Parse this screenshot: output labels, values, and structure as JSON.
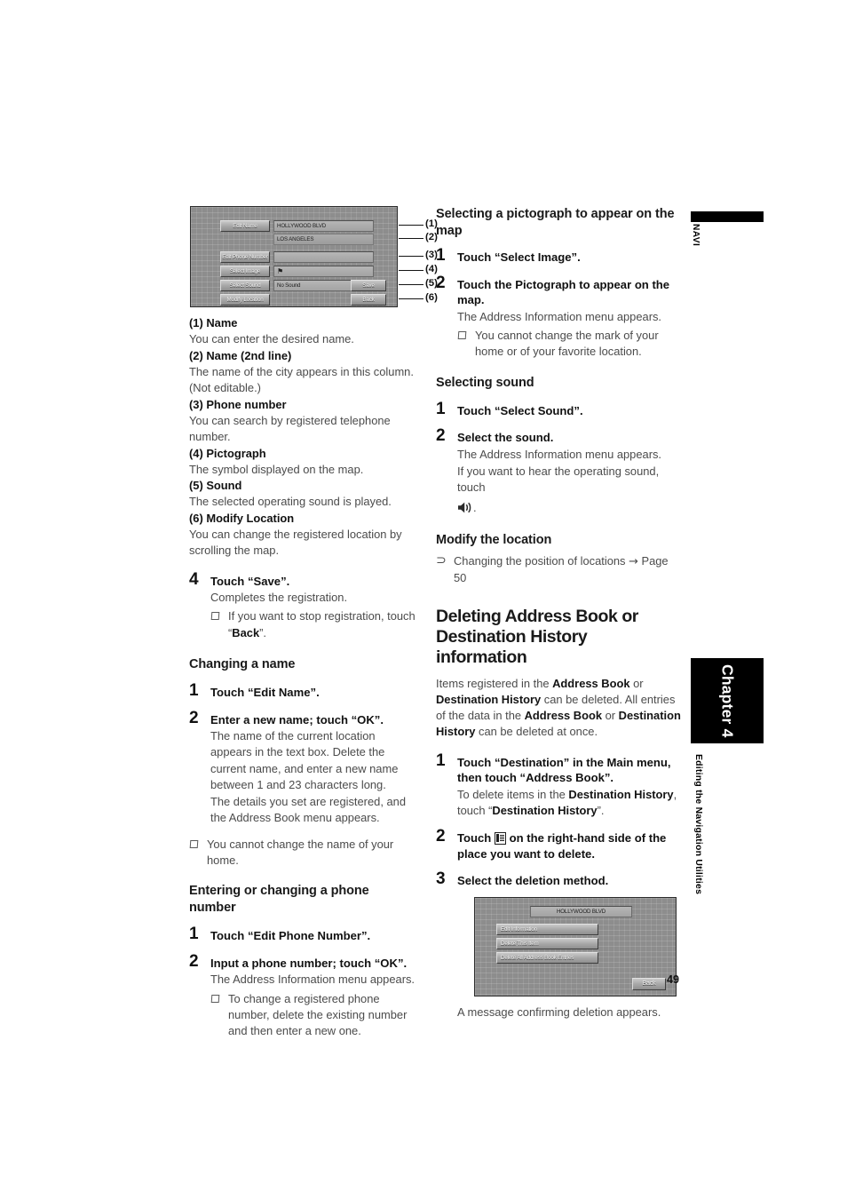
{
  "page": {
    "number": "49",
    "thumb_tab_top": "NAVI",
    "chapter_tab": "Chapter 4",
    "chapter_subtitle": "Editing the Navigation Utilities"
  },
  "figure_address_info": {
    "caption_icon": "navi-address-info-screen",
    "rows": [
      {
        "button": "Edit Name",
        "value": "HOLLYWOOD BLVD"
      },
      {
        "button": "",
        "value": "LOS ANGELES"
      },
      {
        "button": "Edit Phone Number",
        "value": ""
      },
      {
        "button": "Select Image",
        "value": "⚑"
      },
      {
        "button": "Select Sound",
        "value": "No Sound"
      },
      {
        "button": "Modify Location",
        "value": ""
      }
    ],
    "save_label": "Save",
    "back_label": "Back",
    "callouts": [
      "(1)",
      "(2)",
      "(3)",
      "(4)",
      "(5)",
      "(6)"
    ]
  },
  "left_column": {
    "descriptions": [
      {
        "heading": "(1) Name",
        "body": "You can enter the desired name."
      },
      {
        "heading": "(2) Name (2nd line)",
        "body": "The name of the city appears in this column. (Not editable.)"
      },
      {
        "heading": "(3) Phone number",
        "body": "You can search by registered telephone number."
      },
      {
        "heading": "(4) Pictograph",
        "body": "The symbol displayed on the map."
      },
      {
        "heading": "(5) Sound",
        "body": "The selected operating sound is played."
      },
      {
        "heading": "(6) Modify Location",
        "body": "You can change the registered location by scrolling the map."
      }
    ],
    "step4": {
      "num": "4",
      "title": "Touch “Save”.",
      "body": "Completes the registration.",
      "note_pre": "If you want to stop registration, touch “",
      "note_bold": "Back",
      "note_post": "”."
    },
    "section_changing_name": {
      "heading": "Changing a name",
      "step1": {
        "num": "1",
        "title": "Touch “Edit Name”."
      },
      "step2": {
        "num": "2",
        "title": "Enter a new name; touch “OK”.",
        "body1": "The name of the current location appears in the text box. Delete the current name, and enter a new name between 1 and 23 characters long.",
        "body2": "The details you set are registered, and the Address Book menu appears."
      },
      "note": "You cannot change the name of your home."
    },
    "section_phone": {
      "heading": "Entering or changing a phone number",
      "step1": {
        "num": "1",
        "title": "Touch “Edit Phone Number”."
      },
      "step2": {
        "num": "2",
        "title": "Input a phone number; touch “OK”.",
        "body": "The Address Information menu appears.",
        "note": "To change a registered phone number, delete the existing number and then enter a new one."
      }
    }
  },
  "right_column": {
    "section_pictograph": {
      "heading": "Selecting a pictograph to appear on the map",
      "step1": {
        "num": "1",
        "title": "Touch “Select Image”."
      },
      "step2": {
        "num": "2",
        "title": "Touch the Pictograph to appear on the map.",
        "body": "The Address Information menu appears.",
        "note": "You cannot change the mark of your home or of your favorite location."
      }
    },
    "section_sound": {
      "heading": "Selecting sound",
      "step1": {
        "num": "1",
        "title": "Touch “Select Sound”."
      },
      "step2": {
        "num": "2",
        "title": "Select the sound.",
        "body1": "The Address Information menu appears.",
        "body2_pre": "If you want to hear the operating sound, touch ",
        "body2_icon": "speaker-icon",
        "body2_post": "."
      }
    },
    "section_modify": {
      "heading": "Modify the location",
      "ref_glyph": "⊃",
      "ref_text": "Changing the position of locations",
      "ref_arrow": "→",
      "ref_page": "Page 50"
    },
    "section_deleting": {
      "heading": "Deleting Address Book or Destination History information",
      "intro_1": "Items registered in the ",
      "intro_b1": "Address Book",
      "intro_2": " or ",
      "intro_b2": "Destination History",
      "intro_3": " can be deleted. All entries of the data in the ",
      "intro_b3": "Address Book",
      "intro_4": " or ",
      "intro_b4": "Destination History",
      "intro_5": " can be deleted at once.",
      "step1": {
        "num": "1",
        "title": "Touch “Destination” in the Main menu, then touch “Address Book”.",
        "body_pre": "To delete items in the ",
        "body_bold": "Destination History",
        "body_mid": ", touch “",
        "body_bold2": "Destination History",
        "body_post": "”."
      },
      "step2": {
        "num": "2",
        "title_pre": "Touch ",
        "title_icon": "list-icon",
        "title_post": " on the right-hand side of the place you want to delete."
      },
      "step3": {
        "num": "3",
        "title": "Select the deletion method.",
        "caption": "A message confirming deletion appears."
      }
    }
  },
  "figure_delete_menu": {
    "title": "HOLLYWOOD BLVD",
    "items": [
      "Edit Information",
      "Delete This Item",
      "Delete All Address Book Entries"
    ],
    "back_label": "Back"
  },
  "colors": {
    "ink": "#1a1a1a",
    "body_gray": "#4b4b4b",
    "tab_black": "#000000",
    "screen_gray": "#8d8d8d"
  }
}
